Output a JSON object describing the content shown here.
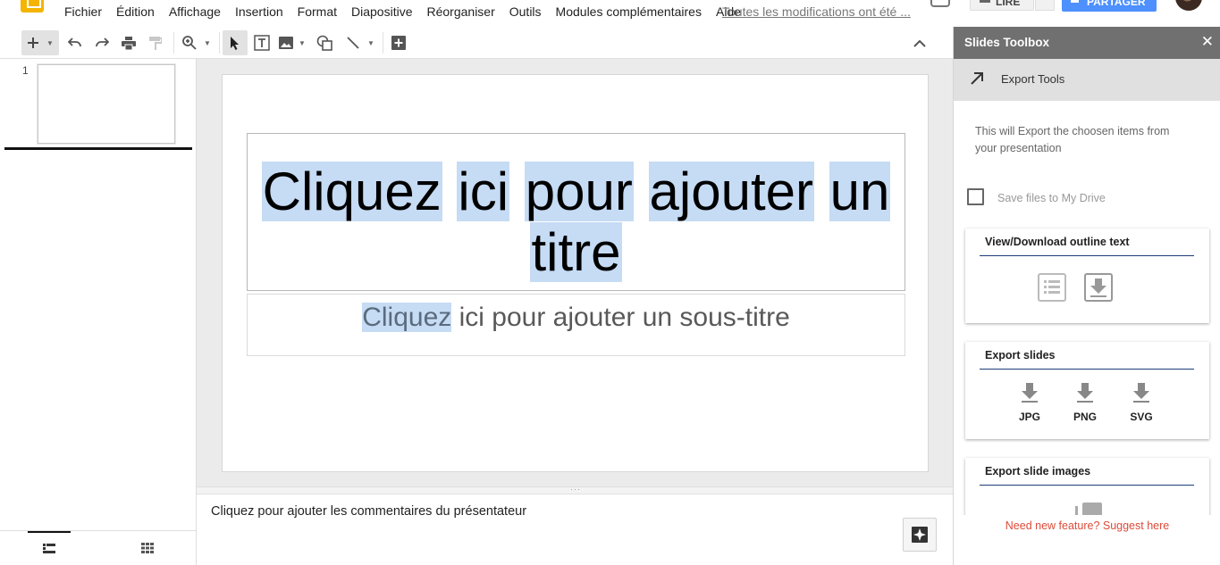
{
  "menubar": {
    "items": [
      "Fichier",
      "Édition",
      "Affichage",
      "Insertion",
      "Format",
      "Diapositive",
      "Réorganiser",
      "Outils",
      "Modules complémentaires",
      "Aide"
    ],
    "save_status": "Toutes les modifications ont été ...",
    "present_label": "LIRE",
    "share_label": "PARTAGER",
    "share_color": "#4d90fe",
    "logo_color": "#f4b400"
  },
  "filmstrip": {
    "slide_number": "1"
  },
  "slide": {
    "title_words": [
      "Cliquez",
      "ici",
      "pour",
      "ajouter",
      "un",
      "titre"
    ],
    "subtitle_highlighted": "Cliquez",
    "subtitle_rest": " ici pour ajouter un sous-titre"
  },
  "notes": {
    "placeholder": "Cliquez pour ajouter les commentaires du présentateur"
  },
  "sidepanel": {
    "title": "Slides Toolbox",
    "close_icon": "close-icon",
    "section_label": "Export Tools",
    "description": "This will Export the choosen items from your presentation",
    "checkbox_label": "Save files to My Drive",
    "cards": {
      "outline_title": "View/Download outline text",
      "slides_title": "Export slides",
      "formats": [
        "JPG",
        "PNG",
        "SVG"
      ],
      "images_title": "Export slide images"
    },
    "footer_link": "Need new feature? Suggest here",
    "header_color": "#707070",
    "link_color": "#dd4b39"
  }
}
